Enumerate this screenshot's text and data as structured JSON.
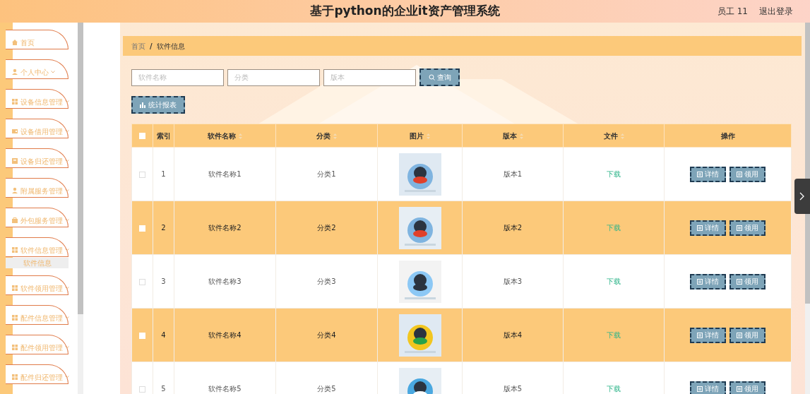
{
  "header": {
    "title": "基于python的企业it资产管理系统",
    "user": "员工 11",
    "logout": "退出登录"
  },
  "sidebar": {
    "items": [
      {
        "label": "首页",
        "kind": "home",
        "expandable": false
      },
      {
        "label": "个人中心",
        "kind": "user",
        "expandable": true
      },
      {
        "label": "设备信息管理",
        "kind": "grid",
        "expandable": true
      },
      {
        "label": "设备借用管理",
        "kind": "card",
        "expandable": true
      },
      {
        "label": "设备归还管理",
        "kind": "box",
        "expandable": true
      },
      {
        "label": "附属服务管理",
        "kind": "user",
        "expandable": true
      },
      {
        "label": "外包服务管理",
        "kind": "bag",
        "expandable": true
      },
      {
        "label": "软件信息管理",
        "kind": "grid",
        "expandable": true,
        "children": [
          {
            "label": "软件信息",
            "selected": true
          }
        ]
      },
      {
        "label": "软件领用管理",
        "kind": "grid",
        "expandable": true
      },
      {
        "label": "配件信息管理",
        "kind": "grid",
        "expandable": true
      },
      {
        "label": "配件领用管理",
        "kind": "grid",
        "expandable": true
      },
      {
        "label": "配件归还管理",
        "kind": "grid",
        "expandable": true
      }
    ]
  },
  "breadcrumb": [
    "首页",
    "软件信息"
  ],
  "breadcrumb_separator": "/",
  "search": {
    "fields": [
      {
        "placeholder": "软件名称"
      },
      {
        "placeholder": "分类"
      },
      {
        "placeholder": "版本"
      }
    ],
    "button": "查询"
  },
  "report_button": "统计报表",
  "table": {
    "columns": [
      {
        "kind": "checkbox",
        "sortable": false,
        "checked": false
      },
      {
        "label": "索引",
        "kind": "text",
        "sortable": false
      },
      {
        "label": "软件名称",
        "kind": "text",
        "sortable": true
      },
      {
        "label": "分类",
        "kind": "text",
        "sortable": true
      },
      {
        "label": "图片",
        "kind": "text",
        "sortable": true
      },
      {
        "label": "版本",
        "kind": "text",
        "sortable": true
      },
      {
        "label": "文件",
        "kind": "text",
        "sortable": true
      },
      {
        "label": "操作",
        "kind": "text",
        "sortable": false
      }
    ],
    "rows": [
      {
        "checked": false,
        "index": "1",
        "name": "软件名称1",
        "category": "分类1",
        "picture": {
          "kind": "picture"
        },
        "version": "版本1",
        "file": "下载",
        "actions": [
          "详情",
          "领用"
        ]
      },
      {
        "checked": false,
        "index": "2",
        "name": "软件名称2",
        "category": "分类2",
        "picture": {
          "kind": "picture"
        },
        "version": "版本2",
        "file": "下载",
        "actions": [
          "详情",
          "领用"
        ]
      },
      {
        "checked": false,
        "index": "3",
        "name": "软件名称3",
        "category": "分类3",
        "picture": {
          "kind": "picture"
        },
        "version": "版本3",
        "file": "下载",
        "actions": [
          "详情",
          "领用"
        ]
      },
      {
        "checked": false,
        "index": "4",
        "name": "软件名称4",
        "category": "分类4",
        "picture": {
          "kind": "picture"
        },
        "version": "版本4",
        "file": "下载",
        "actions": [
          "详情",
          "领用"
        ]
      },
      {
        "checked": false,
        "index": "5",
        "name": "软件名称5",
        "category": "分类5",
        "picture": {
          "kind": "picture"
        },
        "version": "版本5",
        "file": "下载",
        "actions": [
          "详情",
          "领用"
        ]
      }
    ]
  }
}
